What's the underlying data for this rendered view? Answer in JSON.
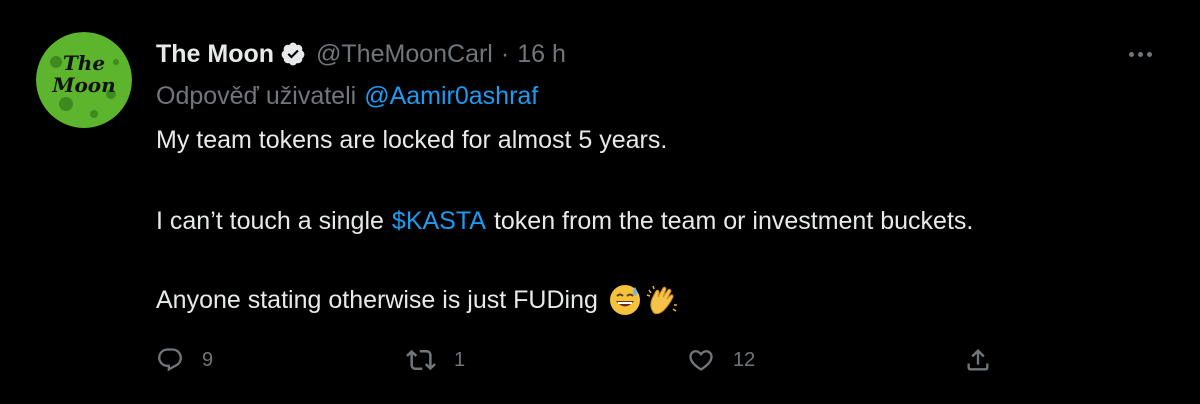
{
  "tweet": {
    "author": {
      "display_name": "The Moon",
      "handle": "@TheMoonCarl",
      "verified": true,
      "avatar_text_top": "The",
      "avatar_text_bottom": "Moon"
    },
    "separator": "·",
    "time": "16 h",
    "reply_to_label": "Odpověď uživateli",
    "reply_to_handle": "@Aamir0ashraf",
    "text": {
      "line1": "My team tokens are locked for almost 5 years.",
      "line2_before": "I can’t touch a single",
      "line2_cashtag": "$KASTA",
      "line2_after": "token from the team or investment buckets.",
      "line3": "Anyone stating otherwise is just FUDing"
    },
    "emojis": [
      "sweat-smile-emoji",
      "clapping-hands-emoji"
    ],
    "actions": {
      "replies": "9",
      "retweets": "1",
      "likes": "12"
    }
  },
  "colors": {
    "background": "#000000",
    "text": "#e7e9ea",
    "secondary": "#71767b",
    "link": "#1d9bf0",
    "avatar_green": "#59b22c"
  }
}
